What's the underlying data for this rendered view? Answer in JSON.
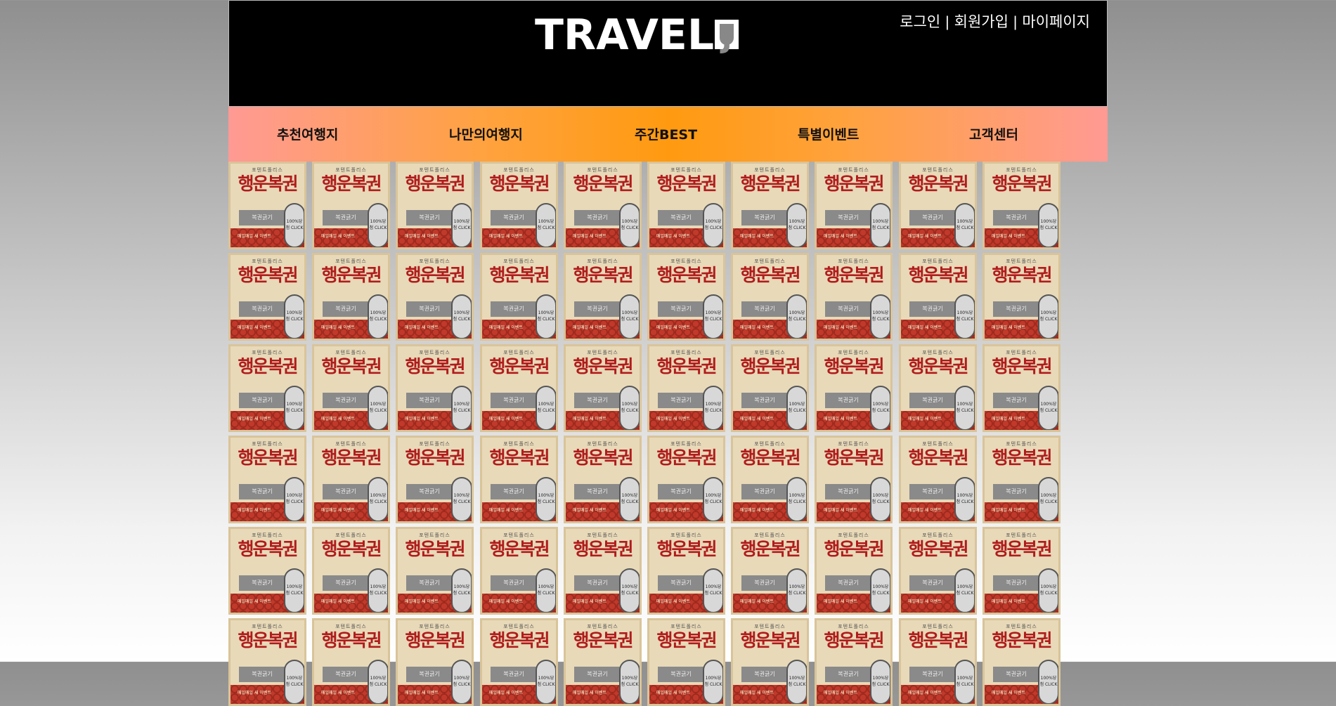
{
  "header": {
    "logo_text": "TRAVEL",
    "logo_box": "J",
    "links": [
      "로그인",
      "회원가입",
      "마이페이지"
    ],
    "separator": "|"
  },
  "nav": {
    "items": [
      "추천여행지",
      "나만의여행지",
      "주간BEST",
      "특별이벤트",
      "고객센터"
    ]
  },
  "ticket": {
    "top_text": "포텐트폴리스",
    "title": "행운복권",
    "bar_text": "복권긁기",
    "circle_text": "100%당첨 CLICK",
    "bottom_text": "매일매일 새 이벤트",
    "rows": 6,
    "cols": 10
  },
  "colors": {
    "header_bg": "#000000",
    "nav_center": "#ff9a10",
    "nav_edge": "#ff9a94",
    "ticket_red": "#b01c1c"
  }
}
